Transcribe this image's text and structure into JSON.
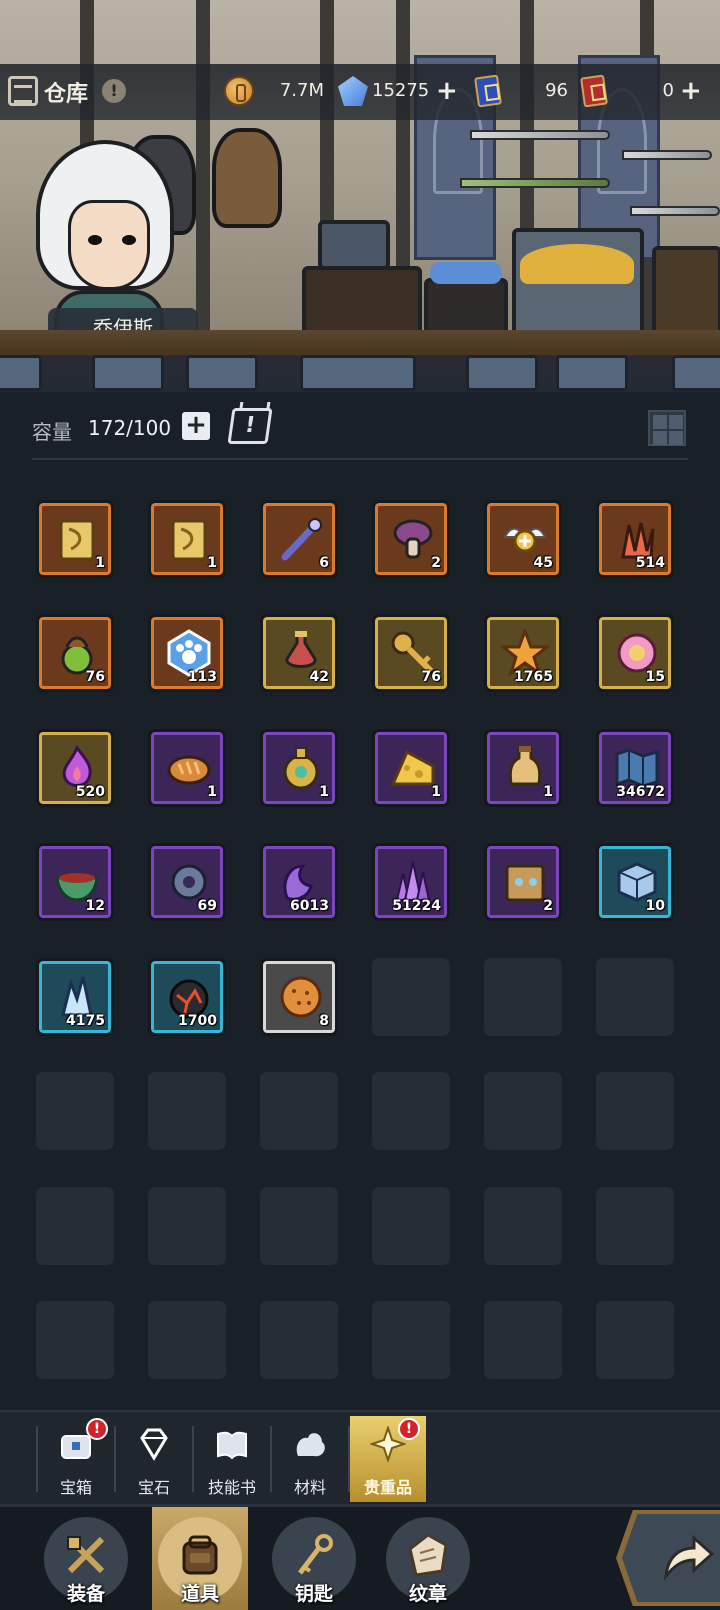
{
  "header": {
    "title": "仓库",
    "info_badge": "!",
    "character_name": "乔伊斯"
  },
  "resources": [
    {
      "name": "gold",
      "icon": "gold-coin-icon",
      "value": "7.7M",
      "addable": false
    },
    {
      "name": "diamond",
      "icon": "diamond-icon",
      "value": "15275",
      "addable": true
    },
    {
      "name": "blue-ticket",
      "icon": "blue-card-icon",
      "value": "96",
      "addable": false
    },
    {
      "name": "red-ticket",
      "icon": "red-card-icon",
      "value": "0",
      "addable": true
    }
  ],
  "capacity": {
    "label": "容量",
    "value": "172/100",
    "plus_symbol": "+"
  },
  "rarity_colors": {
    "orange": "#d97a2c",
    "gold": "#d6b14a",
    "purple": "#7d45c2",
    "cyan": "#35b7d6",
    "white": "#d8d8d8"
  },
  "items": [
    {
      "icon": "scroll-icon",
      "qty": "1",
      "rarity": "orange"
    },
    {
      "icon": "scroll-icon",
      "qty": "1",
      "rarity": "orange"
    },
    {
      "icon": "wand-icon",
      "qty": "6",
      "rarity": "orange"
    },
    {
      "icon": "mushroom-icon",
      "qty": "2",
      "rarity": "orange"
    },
    {
      "icon": "winged-halo-icon",
      "qty": "45",
      "rarity": "orange"
    },
    {
      "icon": "coral-crystal-icon",
      "qty": "514",
      "rarity": "orange"
    },
    {
      "icon": "fruit-bag-icon",
      "qty": "76",
      "rarity": "orange"
    },
    {
      "icon": "paw-badge-icon",
      "qty": "113",
      "rarity": "orange"
    },
    {
      "icon": "potion-bottle-icon",
      "qty": "42",
      "rarity": "gold"
    },
    {
      "icon": "key-icon",
      "qty": "76",
      "rarity": "gold"
    },
    {
      "icon": "star-crystal-icon",
      "qty": "1765",
      "rarity": "gold"
    },
    {
      "icon": "pink-orb-icon",
      "qty": "15",
      "rarity": "gold"
    },
    {
      "icon": "flame-icon",
      "qty": "520",
      "rarity": "gold"
    },
    {
      "icon": "bread-icon",
      "qty": "1",
      "rarity": "purple"
    },
    {
      "icon": "jeweled-flask-icon",
      "qty": "1",
      "rarity": "purple"
    },
    {
      "icon": "cheese-icon",
      "qty": "1",
      "rarity": "purple"
    },
    {
      "icon": "bottle-icon",
      "qty": "1",
      "rarity": "purple"
    },
    {
      "icon": "map-icon",
      "qty": "34672",
      "rarity": "purple"
    },
    {
      "icon": "bowl-icon",
      "qty": "12",
      "rarity": "purple"
    },
    {
      "icon": "gear-ore-icon",
      "qty": "69",
      "rarity": "purple"
    },
    {
      "icon": "purple-stone-icon",
      "qty": "6013",
      "rarity": "purple"
    },
    {
      "icon": "amethyst-icon",
      "qty": "51224",
      "rarity": "purple"
    },
    {
      "icon": "wooden-box-icon",
      "qty": "2",
      "rarity": "purple"
    },
    {
      "icon": "ice-cube-icon",
      "qty": "10",
      "rarity": "cyan"
    },
    {
      "icon": "ice-crystal-icon",
      "qty": "4175",
      "rarity": "cyan"
    },
    {
      "icon": "lava-rock-icon",
      "qty": "1700",
      "rarity": "cyan"
    },
    {
      "icon": "cookie-icon",
      "qty": "8",
      "rarity": "white"
    }
  ],
  "empty_slot_count": 21,
  "categories": [
    {
      "label": "宝箱",
      "icon": "chest-icon",
      "alert": true,
      "active": false
    },
    {
      "label": "宝石",
      "icon": "gem-outline-icon",
      "alert": false,
      "active": false
    },
    {
      "label": "技能书",
      "icon": "book-icon",
      "alert": false,
      "active": false
    },
    {
      "label": "材料",
      "icon": "ore-icon",
      "alert": false,
      "active": false
    },
    {
      "label": "贵重品",
      "icon": "star-gem-icon",
      "alert": true,
      "active": true
    }
  ],
  "alert_symbol": "!",
  "nav": [
    {
      "label": "装备",
      "icon": "equipment-icon",
      "active": false
    },
    {
      "label": "道具",
      "icon": "backpack-icon",
      "active": true
    },
    {
      "label": "钥匙",
      "icon": "key-nav-icon",
      "active": false
    },
    {
      "label": "纹章",
      "icon": "emblem-icon",
      "active": false
    }
  ]
}
